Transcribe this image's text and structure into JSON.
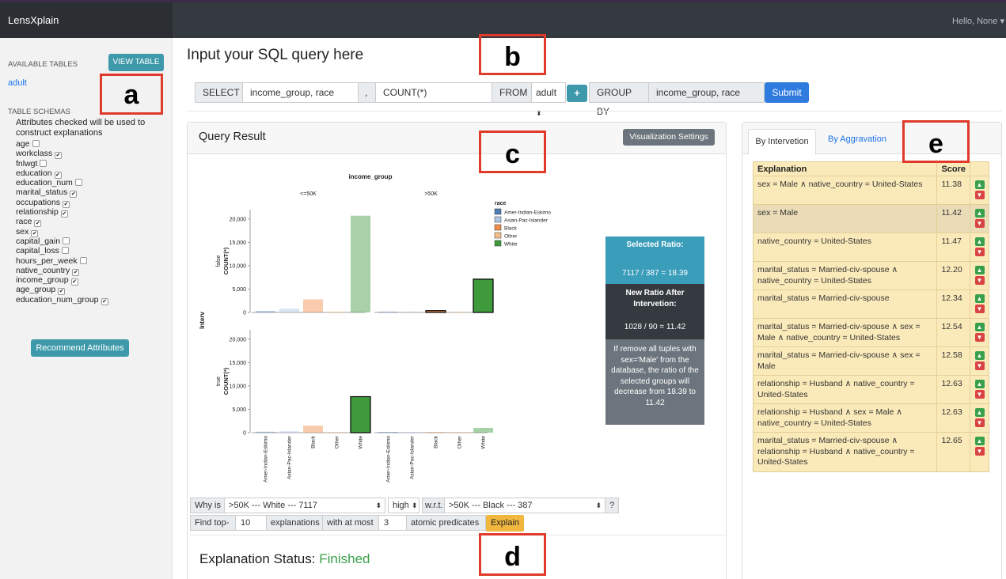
{
  "app": {
    "brand": "LensXplain",
    "user_menu": "Hello, None ▾"
  },
  "sidebar": {
    "available_tables_label": "AVAILABLE TABLES",
    "view_table_button": "VIEW TABLE",
    "table_name": "adult",
    "schemas_label": "TABLE SCHEMAS",
    "schemas_description": "Attributes checked will be used to construct explanations",
    "attributes": [
      {
        "name": "age",
        "checked": false
      },
      {
        "name": "workclass",
        "checked": true
      },
      {
        "name": "fnlwgt",
        "checked": false
      },
      {
        "name": "education",
        "checked": true
      },
      {
        "name": "education_num",
        "checked": false
      },
      {
        "name": "marital_status",
        "checked": true
      },
      {
        "name": "occupations",
        "checked": true
      },
      {
        "name": "relationship",
        "checked": true
      },
      {
        "name": "race",
        "checked": true
      },
      {
        "name": "sex",
        "checked": true
      },
      {
        "name": "capital_gain",
        "checked": false
      },
      {
        "name": "capital_loss",
        "checked": false
      },
      {
        "name": "hours_per_week",
        "checked": false
      },
      {
        "name": "native_country",
        "checked": true
      },
      {
        "name": "income_group",
        "checked": true
      },
      {
        "name": "age_group",
        "checked": true
      },
      {
        "name": "education_num_group",
        "checked": true
      }
    ],
    "recommend_button": "Recommend Attributes"
  },
  "query": {
    "title": "Input your SQL query here",
    "select_label": "SELECT",
    "select_value": "income_group, race",
    "comma": ",",
    "agg_value": "COUNT(*)",
    "from_label": "FROM",
    "from_value": "adult",
    "plus_label": "+",
    "group_by_label": "GROUP BY",
    "group_by_value": "income_group, race",
    "submit_button": "Submit"
  },
  "result": {
    "title": "Query Result",
    "vis_settings_button": "Visualization Settings"
  },
  "ratio_panel": {
    "selected_ratio_label": "Selected Ratio:",
    "selected_ratio_value": "7117 / 387 = 18.39",
    "new_ratio_label": "New Ratio After Intervetion:",
    "new_ratio_value": "1028 / 90 = 11.42",
    "description": "If remove all tuples with sex='Male' from the database, the ratio of the selected groups will decrease from 18.39 to 11.42"
  },
  "why": {
    "why_is_label": "Why is",
    "group1_value": ">50K --- White --- 7117",
    "direction_value": "high",
    "wrt_label": "w.r.t.",
    "group2_value": ">50K --- Black --- 387",
    "question_mark": "?",
    "find_top_label": "Find top-",
    "top_k_value": "10",
    "explanations_label": "explanations",
    "with_at_most_label": "with at most",
    "predicates_value": "3",
    "atomic_predicates_label": "atomic predicates",
    "explain_button": "Explain"
  },
  "status": {
    "label": "Explanation Status:",
    "value": "Finished"
  },
  "explanations_panel": {
    "tabs": [
      "By Intervetion",
      "By Aggravation"
    ],
    "headers": {
      "explanation": "Explanation",
      "score": "Score"
    },
    "rows": [
      {
        "text": "sex = Male ∧ native_country = United-States",
        "score": "11.38"
      },
      {
        "text": "sex = Male",
        "score": "11.42"
      },
      {
        "text": "native_country = United-States",
        "score": "11.47"
      },
      {
        "text": "marital_status = Married-civ-spouse ∧ native_country = United-States",
        "score": "12.20"
      },
      {
        "text": "marital_status = Married-civ-spouse",
        "score": "12.34"
      },
      {
        "text": "marital_status = Married-civ-spouse ∧ sex = Male ∧ native_country = United-States",
        "score": "12.54"
      },
      {
        "text": "marital_status = Married-civ-spouse ∧ sex = Male",
        "score": "12.58"
      },
      {
        "text": "relationship = Husband ∧ native_country = United-States",
        "score": "12.63"
      },
      {
        "text": "relationship = Husband ∧ sex = Male ∧ native_country = United-States",
        "score": "12.63"
      },
      {
        "text": "marital_status = Married-civ-spouse ∧ relationship = Husband ∧ native_country = United-States",
        "score": "12.65"
      }
    ]
  },
  "annotations": [
    "a",
    "b",
    "c",
    "d",
    "e"
  ],
  "colors": {
    "Amer-Indian-Eskimo": "#4f7fb5",
    "Asian-Pac-Islander": "#adc6e6",
    "Black": "#ef8f4a",
    "Other": "#f5bf8a",
    "White": "#3f9a3c"
  },
  "chart_data": {
    "type": "bar",
    "title": "income_group",
    "facet_columns": [
      "<=50K",
      ">50K"
    ],
    "row_facet_label": "Interv",
    "row_facets": [
      "false",
      "true"
    ],
    "ylabel": "COUNT(*)",
    "ylim": [
      0,
      22000
    ],
    "yticks": [
      0,
      5000,
      10000,
      15000,
      20000
    ],
    "categories": [
      "Amer-Indian-Eskimo",
      "Asian-Pac-Islander",
      "Black",
      "Other",
      "White"
    ],
    "legend_title": "race",
    "legend_position": "top-right",
    "panels": [
      {
        "interv": "false",
        "income_group": "<=50K",
        "values": [
          300,
          800,
          2800,
          200,
          20700
        ],
        "highlight": []
      },
      {
        "interv": "false",
        "income_group": ">50K",
        "values": [
          50,
          200,
          387,
          20,
          7117
        ],
        "highlight": [
          "Black",
          "White"
        ]
      },
      {
        "interv": "true",
        "income_group": "<=50K",
        "values": [
          200,
          300,
          1500,
          100,
          7700
        ],
        "highlight": [
          "White"
        ]
      },
      {
        "interv": "true",
        "income_group": ">50K",
        "values": [
          30,
          80,
          90,
          10,
          1028
        ],
        "highlight": []
      }
    ]
  }
}
